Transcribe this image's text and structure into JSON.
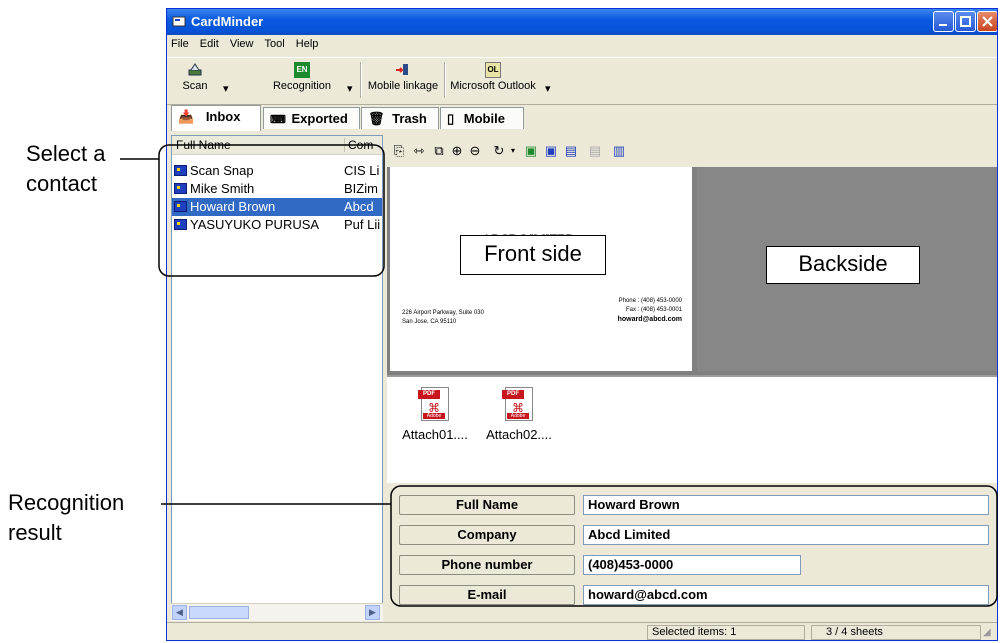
{
  "callouts": {
    "select_contact_line1": "Select a",
    "select_contact_line2": "contact",
    "recognition_line1": "Recognition",
    "recognition_line2": "result",
    "front_side": "Front side",
    "back_side": "Backside"
  },
  "window": {
    "title": "CardMinder"
  },
  "menu": [
    "File",
    "Edit",
    "View",
    "Tool",
    "Help"
  ],
  "toolbar": {
    "scan": "Scan",
    "recognition": "Recognition",
    "mobile_linkage": "Mobile linkage",
    "outlook": "Microsoft Outlook",
    "recognition_badge": "EN",
    "outlook_badge": "OL"
  },
  "tabs": [
    "Inbox",
    "Exported",
    "Trash",
    "Mobile"
  ],
  "list": {
    "columns": [
      "Full Name",
      "Com"
    ],
    "rows": [
      {
        "name": "Scan Snap",
        "company": "CIS Li"
      },
      {
        "name": "Mike Smith",
        "company": "BIZim"
      },
      {
        "name": "Howard Brown",
        "company": "Abcd"
      },
      {
        "name": "YASUYUKO PURUSA",
        "company": "Puf Lii"
      }
    ],
    "selected_index": 2
  },
  "card": {
    "company": "ABCD LIMITED",
    "address1": "226 Airport Parkway, Suite 030",
    "address2": "San Jose, CA 95110",
    "phone": "Phone : (408) 453-0000",
    "fax": "Fax : (408) 453-0001",
    "email": "howard@abcd.com"
  },
  "attachments": [
    "Attach01....",
    "Attach02...."
  ],
  "attachment_badge": "PDF",
  "attachment_brand": "Adobe",
  "fields": [
    {
      "label": "Full Name",
      "value": "Howard Brown"
    },
    {
      "label": "Company",
      "value": "Abcd Limited"
    },
    {
      "label": "Phone number",
      "value": "(408)453-0000"
    },
    {
      "label": "E-mail",
      "value": "howard@abcd.com"
    }
  ],
  "status": {
    "selected": "Selected items:  1",
    "pages": "3 /    4 sheets"
  },
  "colors": {
    "selection": "#316ac5",
    "titlebar": "#0553d7",
    "callout_stroke": "#000000"
  }
}
